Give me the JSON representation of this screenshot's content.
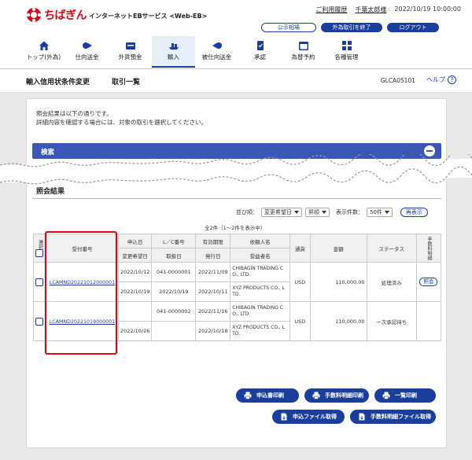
{
  "header": {
    "logo_text": "ちばぎん",
    "logo_sub": "インターネットEBサービス <Web-EB>",
    "links": [
      "ご利用履歴",
      "千葉太郎様"
    ],
    "datetime": "2022/10/19 10:00:00",
    "buttons": [
      "公示相場",
      "外為取引を終了",
      "ログアウト"
    ]
  },
  "nav": [
    {
      "label": "トップ(外為)",
      "icon": "home-icon"
    },
    {
      "label": "仕向送金",
      "icon": "remit-icon"
    },
    {
      "label": "外貨預金",
      "icon": "deposit-icon"
    },
    {
      "label": "輸入",
      "icon": "import-icon"
    },
    {
      "label": "被仕向送金",
      "icon": "receive-icon"
    },
    {
      "label": "承認",
      "icon": "approve-icon"
    },
    {
      "label": "為替予約",
      "icon": "reserve-icon"
    },
    {
      "label": "各種管理",
      "icon": "manage-icon"
    }
  ],
  "page": {
    "title": "輸入信用状条件変更",
    "subtitle": "取引一覧",
    "screen_code": "GLCA05101",
    "help": "ヘルプ"
  },
  "info_lines": [
    "照会結果は以下の通りです。",
    "詳細内容を確認する場合には、対象の取引を選択してください。"
  ],
  "search": {
    "label": "検索"
  },
  "results": {
    "title": "照会結果",
    "sort_label": "並び順：",
    "sort_field": "変更希望日",
    "sort_order": "昇順",
    "per_page_label": "表示件数：",
    "per_page": "50件",
    "redisplay": "再表示",
    "count_text": "全2件（1～2件を表示中）",
    "headers": {
      "select": "選択",
      "receipt_no": "受付番号",
      "apply_date": "申込日",
      "change_date": "変更希望日",
      "lc_no": "L／C番号",
      "handling_date": "取扱日",
      "expiry": "有効期限",
      "issue_date": "発行日",
      "applicant": "依頼人名",
      "beneficiary": "受益者名",
      "currency": "通貨",
      "amount": "金額",
      "status": "ステータス",
      "fee": "手数料明細"
    },
    "rows": [
      {
        "receipt_no": "LCAMND20221012000001",
        "apply_date": "2022/10/12",
        "change_date": "2022/10/19",
        "lc_no": "041-0000001",
        "handling_date": "2022/10/19",
        "expiry": "2022/11/09",
        "issue_date": "2022/10/11",
        "applicant_1": "CHIBAGIN TRADING C",
        "applicant_2": "O., LTD.",
        "beneficiary_1": "XYZ PRODUCTS CO., L",
        "beneficiary_2": "TD.",
        "currency": "USD",
        "amount": "110,000.00",
        "status": "処理済み",
        "fee_button": "照会"
      },
      {
        "receipt_no": "LCAMND20221019000001",
        "apply_date": "",
        "change_date": "2022/10/26",
        "lc_no": "041-0000002",
        "handling_date": "",
        "expiry": "2022/11/16",
        "issue_date": "2022/10/18",
        "applicant_1": "CHIBAGIN TRADING C",
        "applicant_2": "O., LTD.",
        "beneficiary_1": "XYZ PRODUCTS CO., L",
        "beneficiary_2": "TD.",
        "currency": "USD",
        "amount": "110,000.00",
        "status": "一次承認待ち",
        "fee_button": ""
      }
    ]
  },
  "actions": {
    "apply_print": "申込書印刷",
    "fee_print": "手数料明細印刷",
    "list_print": "一覧印刷",
    "apply_file": "申込ファイル取得",
    "fee_file": "手数料明細ファイル取得"
  },
  "colors": {
    "brand_red": "#e60012",
    "accent_blue": "#1a3e9b",
    "search_bar": "#3b57b6"
  }
}
